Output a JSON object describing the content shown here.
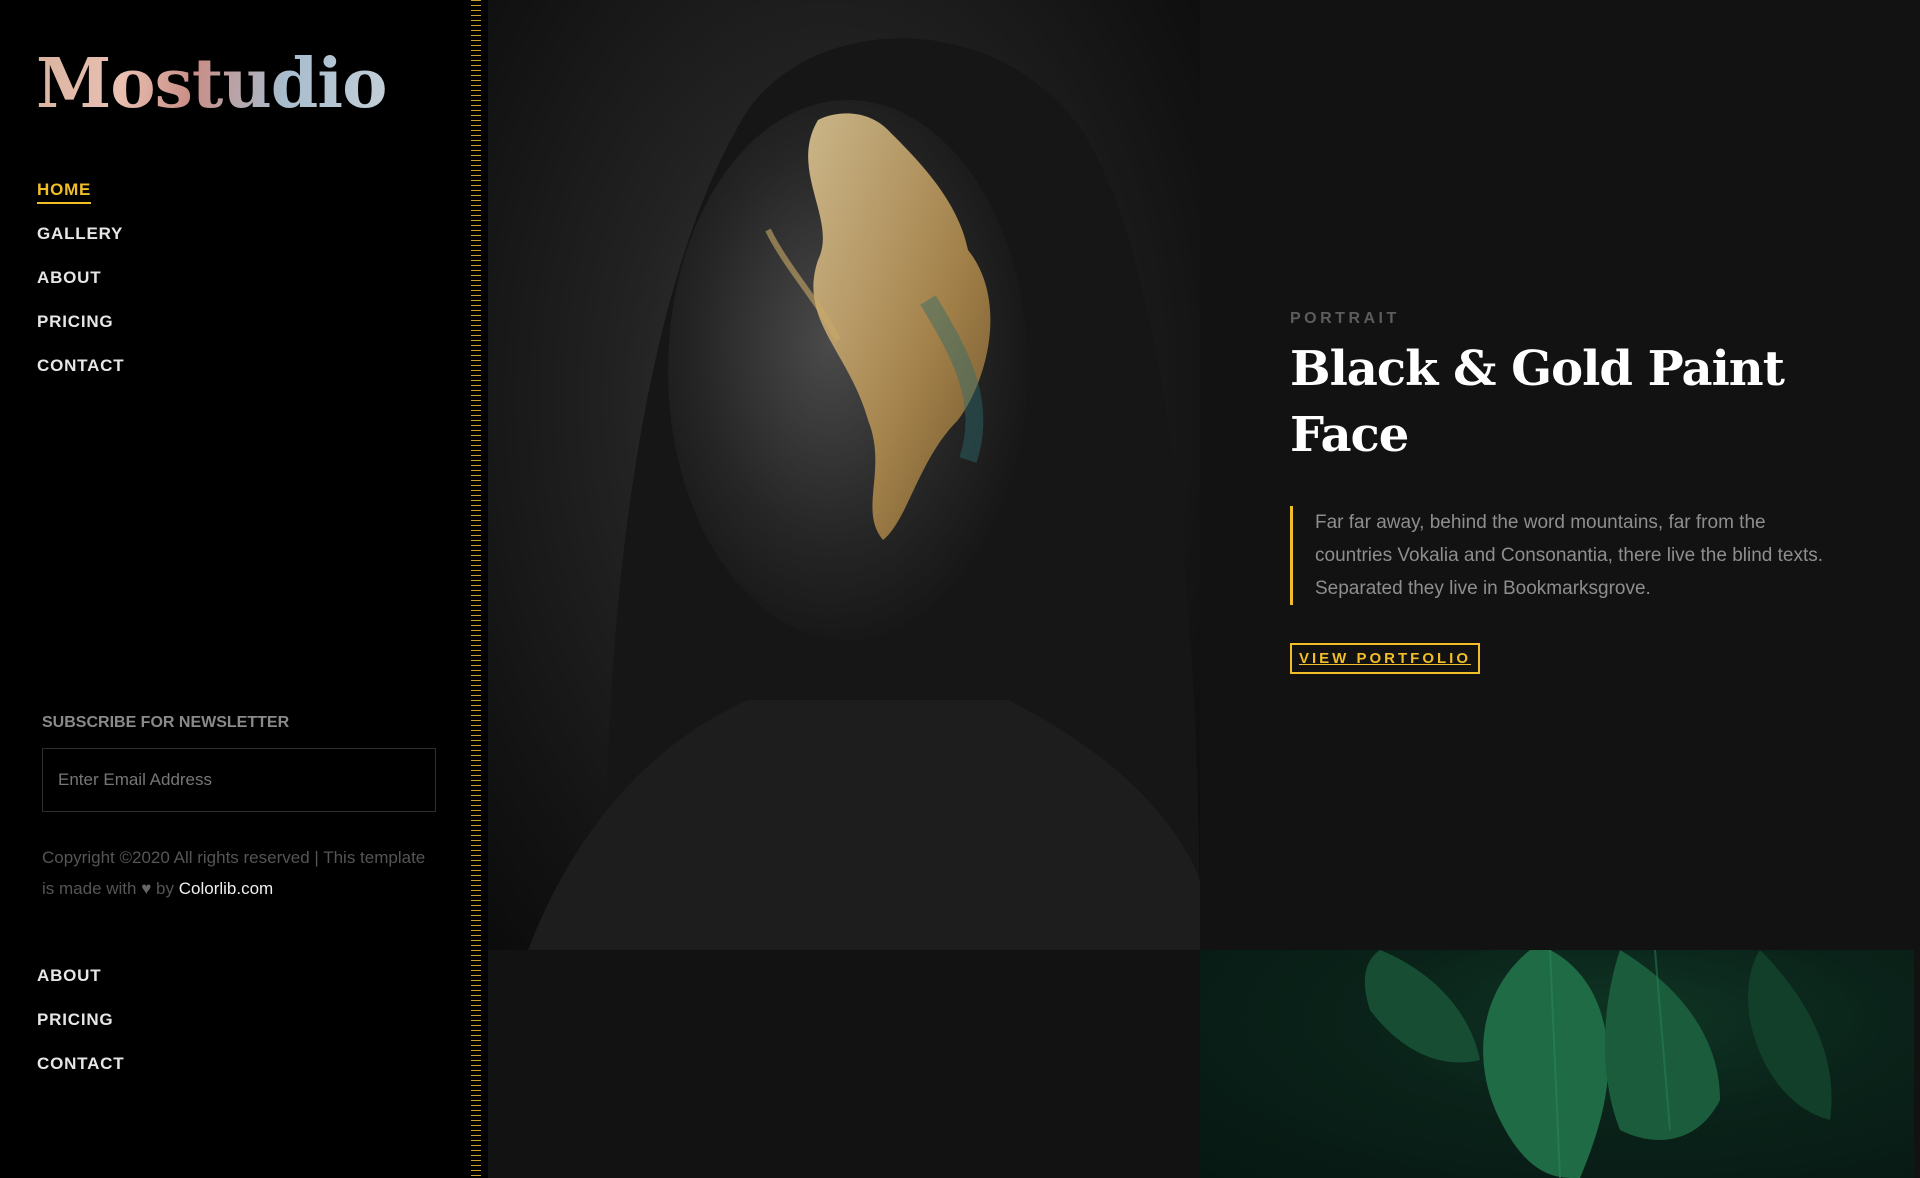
{
  "brand": {
    "logo": "Mostudio"
  },
  "nav_primary": [
    {
      "label": "HOME",
      "active": true
    },
    {
      "label": "GALLERY",
      "active": false
    },
    {
      "label": "ABOUT",
      "active": false
    },
    {
      "label": "PRICING",
      "active": false
    },
    {
      "label": "CONTACT",
      "active": false
    }
  ],
  "newsletter": {
    "title": "SUBSCRIBE FOR NEWSLETTER",
    "placeholder": "Enter Email Address"
  },
  "footer": {
    "copyright_prefix": "Copyright ©2020 All rights reserved | This template is made with",
    "copyright_by": "by",
    "link": "Colorlib.com",
    "heart_icon": "heart-icon"
  },
  "nav_secondary": [
    {
      "label": "ABOUT"
    },
    {
      "label": "PRICING"
    },
    {
      "label": "CONTACT"
    }
  ],
  "hero": {
    "category": "PORTRAIT",
    "title": "Black & Gold Paint Face",
    "description": "Far far away, behind the word mountains, far from the countries Vokalia and Consonantia, there live the blind texts. Separated they live in Bookmarksgrove.",
    "button": "VIEW PORTFOLIO"
  },
  "colors": {
    "accent": "#f1bd29",
    "sidebar_bg": "#000000",
    "main_bg": "#121212"
  }
}
